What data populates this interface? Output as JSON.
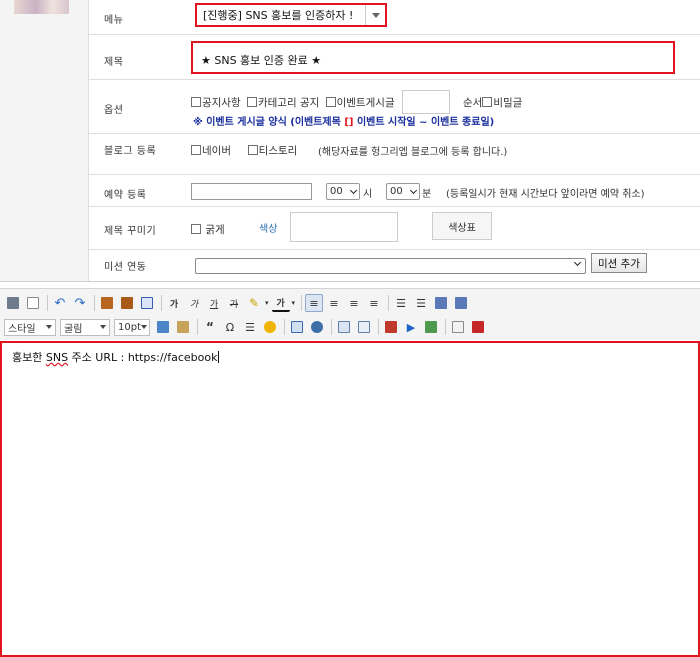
{
  "form": {
    "menu": {
      "label": "메뉴",
      "selected": "[진행중] SNS 홍보를 인증하자 !"
    },
    "title": {
      "label": "제목",
      "value": "★ SNS 홍보 인증 완료 ★"
    },
    "options": {
      "label": "옵션",
      "checkboxes": [
        "공지사항",
        "카테고리 공지",
        "이벤트게시글"
      ],
      "order_label": "순서",
      "secret_label": "비밀글",
      "event_format_prefix": "※ 이벤트 게시글 양식 (",
      "event_format_title": "이벤트제목",
      "event_format_bracket": "[]",
      "event_format_dates": "이벤트 시작일 ~ 이벤트 종료일",
      "event_format_suffix": ")"
    },
    "blog": {
      "label": "블로그 등록",
      "naver": "네이버",
      "tistory": "티스토리",
      "note": "(해당자료를 헝그리엡 블로그에 등록 합니다.)"
    },
    "reservation": {
      "label": "예약 등록",
      "hour_value": "00",
      "hour_unit": "시",
      "minute_value": "00",
      "minute_unit": "분",
      "note": "(등록일시가 현재 시간보다 앞이라면 예약 취소)"
    },
    "title_deco": {
      "label": "제목 꾸미기",
      "bold_label": "굵게",
      "color_label": "색상",
      "color_button": "색상표"
    },
    "mission": {
      "label": "미션 연동",
      "add_button": "미션 추가"
    }
  },
  "toolbar": {
    "style_label": "스타일",
    "font_label": "굴림",
    "size_label": "10pt",
    "bold": "가",
    "italic": "가",
    "underline": "가",
    "strike": "가",
    "omega": "Ω",
    "quote": "“"
  },
  "editor": {
    "text_prefix": "홍보한 ",
    "text_sns": "SNS",
    "text_middle": " 주소 URL : ",
    "text_url": "https://facebook"
  },
  "colors": {
    "highlight_red": "#e0141e",
    "link_blue": "#2a6fb5",
    "event_blue": "#1a2f9e"
  }
}
